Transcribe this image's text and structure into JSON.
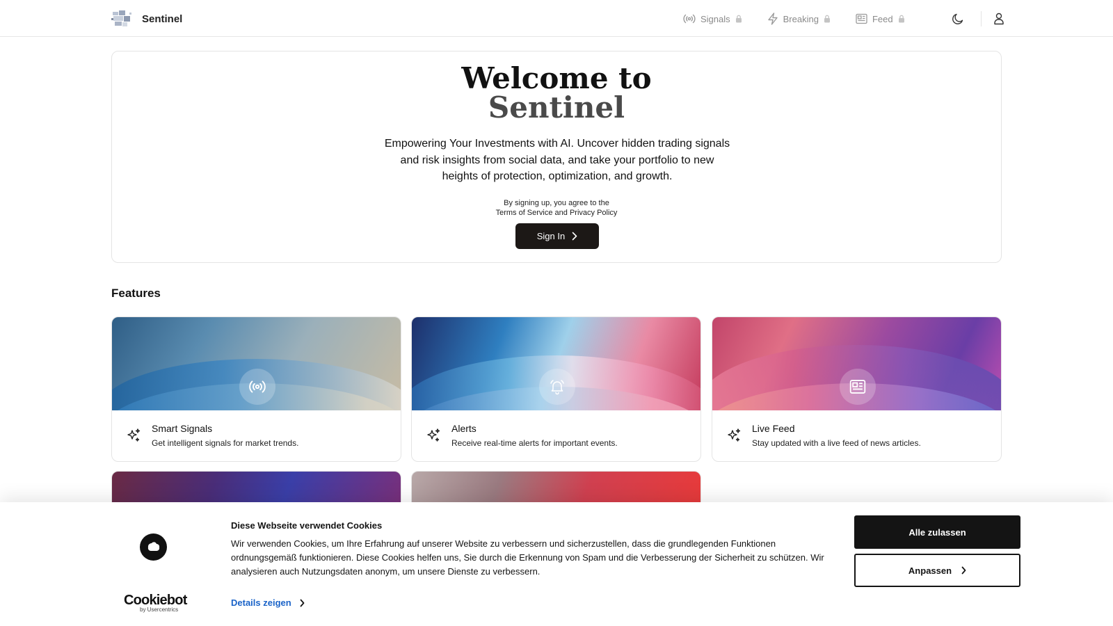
{
  "header": {
    "brand": "Sentinel",
    "nav": [
      {
        "label": "Signals",
        "icon": "broadcast-icon",
        "locked": true
      },
      {
        "label": "Breaking",
        "icon": "lightning-icon",
        "locked": true
      },
      {
        "label": "Feed",
        "icon": "newspaper-icon",
        "locked": true
      }
    ],
    "theme_icon": "moon-icon",
    "user_icon": "user-icon"
  },
  "hero": {
    "title_line1": "Welcome to",
    "title_line2": "Sentinel",
    "subtitle": "Empowering Your Investments with AI. Uncover hidden trading signals and risk insights from social data, and take your portfolio to new heights of protection, optimization, and growth.",
    "terms_line1": "By signing up, you agree to the",
    "terms_line2": "Terms of Service and Privacy Policy",
    "signin_label": "Sign In"
  },
  "features": {
    "title": "Features",
    "items": [
      {
        "title": "Smart Signals",
        "description": "Get intelligent signals for market trends.",
        "icon": "broadcast-icon"
      },
      {
        "title": "Alerts",
        "description": "Receive real-time alerts for important events.",
        "icon": "bell-icon"
      },
      {
        "title": "Live Feed",
        "description": "Stay updated with a live feed of news articles.",
        "icon": "newspaper-icon"
      }
    ]
  },
  "cookie": {
    "title": "Diese Webseite verwendet Cookies",
    "text": "Wir verwenden Cookies, um Ihre Erfahrung auf unserer Website zu verbessern und sicherzustellen, dass die grundlegenden Funktionen ordnungsgemäß funktionieren. Diese Cookies helfen uns, Sie durch die Erkennung von Spam und die Verbesserung der Sicherheit zu schützen. Wir analysieren auch Nutzungsdaten anonym, um unsere Dienste zu verbessern.",
    "details_label": "Details zeigen",
    "allow_label": "Alle zulassen",
    "customize_label": "Anpassen",
    "brand": "Cookiebot",
    "brand_sub": "by Usercentrics"
  },
  "colors": {
    "accent_dark": "#1c1816",
    "link_blue": "#1a63c8",
    "muted_nav": "#8a8a8a"
  }
}
